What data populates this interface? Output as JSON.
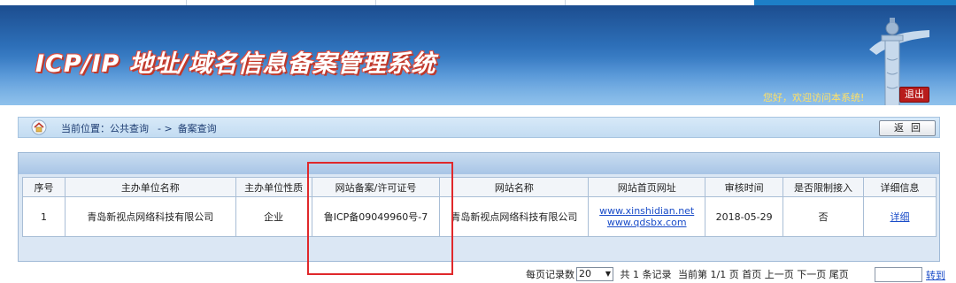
{
  "header": {
    "title": "ICP/IP 地址/域名信息备案管理系统",
    "welcome": "您好，欢迎访问本系统!",
    "logout_label": "退出"
  },
  "location": {
    "prefix": "当前位置：公共查询",
    "separator": "- >",
    "current": "备案查询",
    "back_label": "返回"
  },
  "table": {
    "columns": [
      "序号",
      "主办单位名称",
      "主办单位性质",
      "网站备案/许可证号",
      "网站名称",
      "网站首页网址",
      "审核时间",
      "是否限制接入",
      "详细信息"
    ],
    "rows": [
      {
        "index": "1",
        "org_name": "青岛新视点网络科技有限公司",
        "org_type": "企业",
        "license": "鲁ICP备09049960号-7",
        "site_name": "青岛新视点网络科技有限公司",
        "url_1": "www.xinshidian.net",
        "url_2": "www.qdsbx.com",
        "audit_date": "2018-05-29",
        "restricted": "否",
        "detail_label": "详细"
      }
    ]
  },
  "pager": {
    "per_page_label": "每页记录数",
    "per_page_value": "20",
    "total": "共 1 条记录",
    "current": "当前第 1/1 页",
    "first": "首页",
    "prev": "上一页",
    "next": "下一页",
    "last": "尾页",
    "goto_label": "转到"
  },
  "colors": {
    "banner": "#2d6fb8",
    "logout": "#b81c1c",
    "highlight": "#e0282b",
    "link": "#1a4cc8"
  }
}
